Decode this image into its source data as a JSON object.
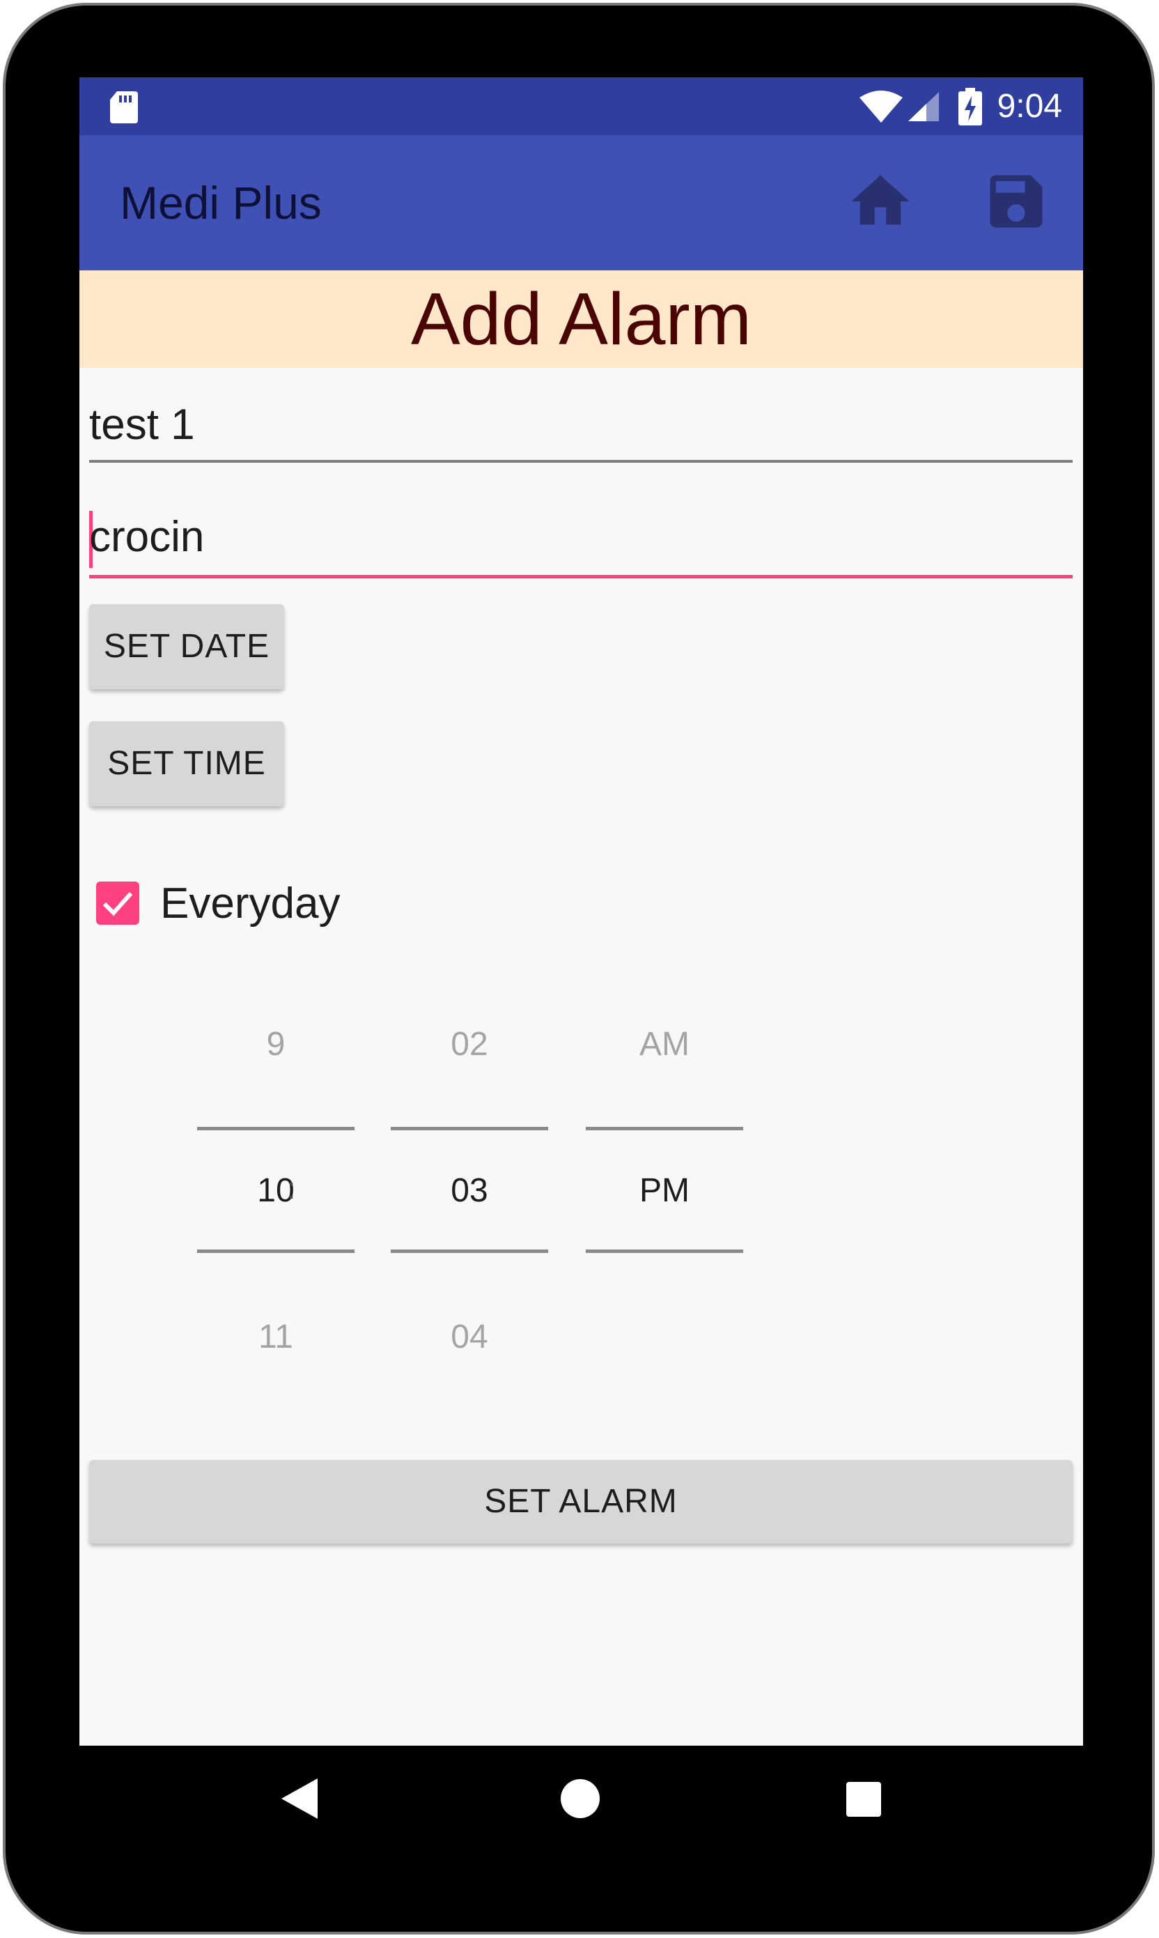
{
  "status_bar": {
    "time": "9:04",
    "icons": [
      "sd-card-icon",
      "wifi-icon",
      "signal-icon",
      "battery-charging-icon"
    ]
  },
  "app_bar": {
    "title": "Medi Plus",
    "actions": [
      "home-icon",
      "save-icon"
    ]
  },
  "header": {
    "title": "Add Alarm"
  },
  "form": {
    "name_value": "test 1",
    "medicine_value": "crocin",
    "set_date_label": "SET DATE",
    "set_time_label": "SET TIME",
    "everyday_label": "Everyday",
    "everyday_checked": true,
    "set_alarm_label": "SET ALARM"
  },
  "time_picker": {
    "hour": {
      "prev": "9",
      "selected": "10",
      "next": "11"
    },
    "separator": ":",
    "minute": {
      "prev": "02",
      "selected": "03",
      "next": "04"
    },
    "ampm": {
      "prev": "AM",
      "selected": "PM"
    }
  },
  "nav_bar": {
    "buttons": [
      "back-icon",
      "home-circle-icon",
      "recent-apps-icon"
    ]
  },
  "colors": {
    "status_bar": "#303f9f",
    "app_bar": "#3f51b5",
    "header_band": "#ffe8c9",
    "header_text": "#4b0404",
    "accent": "#ff4081",
    "button": "#d6d7d7"
  }
}
